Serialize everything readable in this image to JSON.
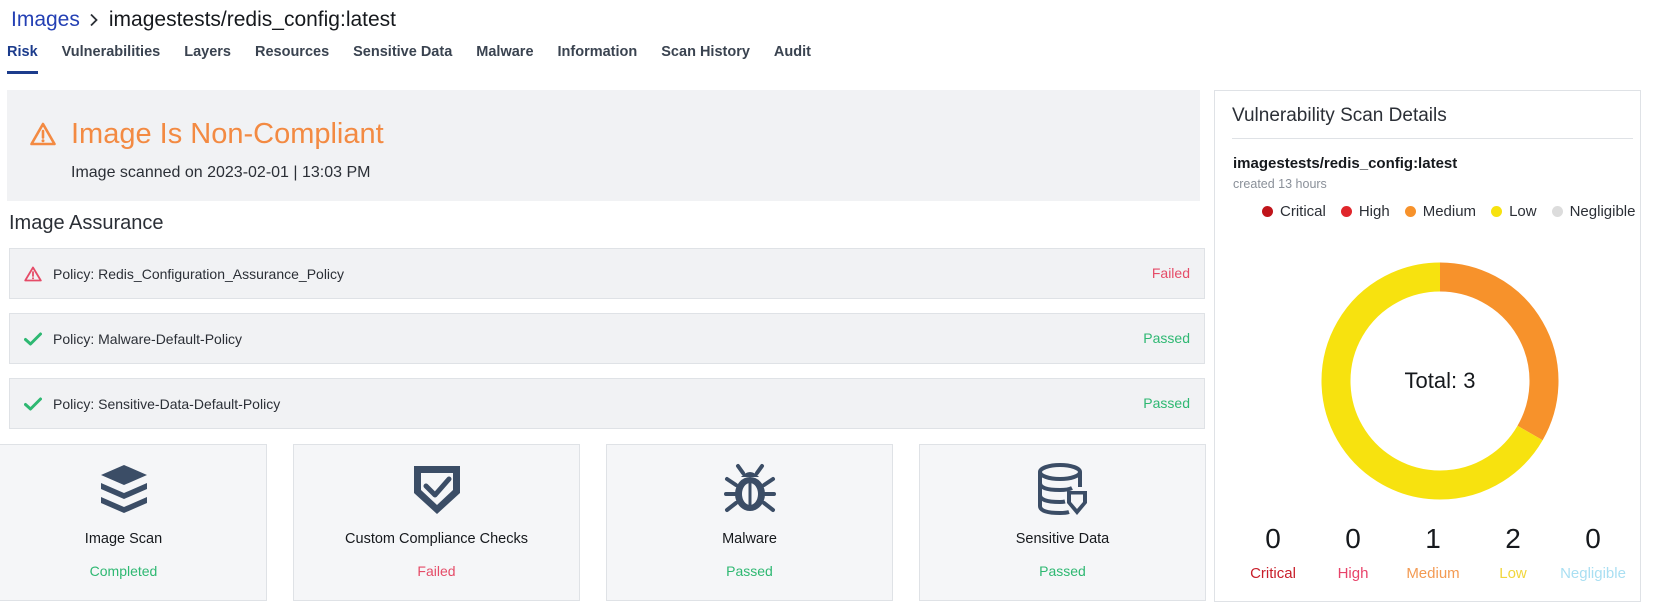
{
  "breadcrumb": {
    "root": "Images",
    "current": "imagestests/redis_config:latest"
  },
  "tabs": [
    {
      "label": "Risk",
      "active": true
    },
    {
      "label": "Vulnerabilities"
    },
    {
      "label": "Layers"
    },
    {
      "label": "Resources"
    },
    {
      "label": "Sensitive Data"
    },
    {
      "label": "Malware"
    },
    {
      "label": "Information"
    },
    {
      "label": "Scan History"
    },
    {
      "label": "Audit"
    }
  ],
  "status": {
    "title": "Image Is Non-Compliant",
    "scanned": "Image scanned on 2023-02-01 | 13:03 PM"
  },
  "assurance": {
    "title": "Image Assurance",
    "policies": [
      {
        "name": "Policy: Redis_Configuration_Assurance_Policy",
        "status": "Failed"
      },
      {
        "name": "Policy: Malware-Default-Policy",
        "status": "Passed"
      },
      {
        "name": "Policy: Sensitive-Data-Default-Policy",
        "status": "Passed"
      }
    ]
  },
  "cards": [
    {
      "title": "Image Scan",
      "status": "Completed",
      "icon": "layers-icon"
    },
    {
      "title": "Custom Compliance Checks",
      "status": "Failed",
      "icon": "shield-check-icon"
    },
    {
      "title": "Malware",
      "status": "Passed",
      "icon": "bug-icon"
    },
    {
      "title": "Sensitive Data",
      "status": "Passed",
      "icon": "database-shield-icon"
    }
  ],
  "scan_details": {
    "title": "Vulnerability Scan Details",
    "image": "imagestests/redis_config:latest",
    "created": "created 13 hours",
    "total_label": "Total: 3",
    "severities": [
      {
        "name": "Critical",
        "count": "0",
        "color": "#c0141a",
        "label_color": "#c81e2a"
      },
      {
        "name": "High",
        "count": "0",
        "color": "#e0262b",
        "label_color": "#e8436a"
      },
      {
        "name": "Medium",
        "count": "1",
        "color": "#f7922b",
        "label_color": "#f39a52"
      },
      {
        "name": "Low",
        "count": "2",
        "color": "#f7e20f",
        "label_color": "#f1d63c"
      },
      {
        "name": "Negligible",
        "count": "0",
        "color": "#dcdcdc",
        "label_color": "#a9dff2"
      }
    ]
  },
  "colors": {
    "accent": "#1c3c8c",
    "warning": "#f38a42",
    "fail": "#e54c68",
    "pass": "#2eb872",
    "icon": "#3b4d66"
  }
}
